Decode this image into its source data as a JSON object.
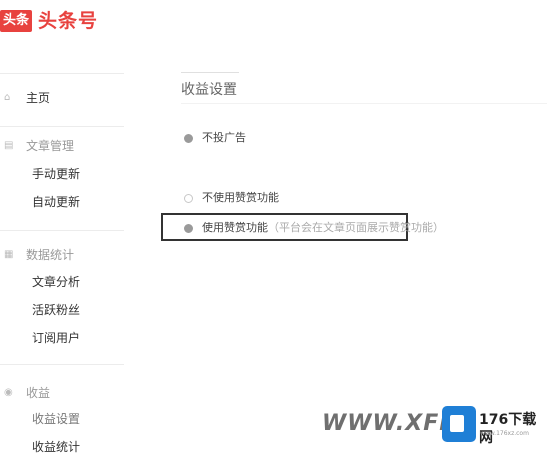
{
  "header": {
    "logo_badge": "头条",
    "logo_text": "头条号"
  },
  "sidebar": {
    "home": "主页",
    "sections": [
      {
        "title": "文章管理",
        "items": [
          "手动更新",
          "自动更新"
        ]
      },
      {
        "title": "数据统计",
        "items": [
          "文章分析",
          "活跃粉丝",
          "订阅用户"
        ]
      },
      {
        "title": "收益",
        "items": [
          "收益设置",
          "收益统计"
        ]
      }
    ]
  },
  "main": {
    "title": "收益设置",
    "options": [
      {
        "label": "不投广告",
        "selected": true,
        "hint": ""
      },
      {
        "label": "不使用赞赏功能",
        "selected": false,
        "hint": ""
      },
      {
        "label": "使用赞赏功能",
        "selected": true,
        "hint": "（平台会在文章页面展示赞赏功能）"
      }
    ]
  },
  "watermark": {
    "text": "WWW.XFDC",
    "brand": "176下载网",
    "domain": "www.176xz.com"
  },
  "colors": {
    "brand_red": "#e8423f",
    "highlight_border": "#333333",
    "watermark_blue": "#1f7fd6"
  }
}
